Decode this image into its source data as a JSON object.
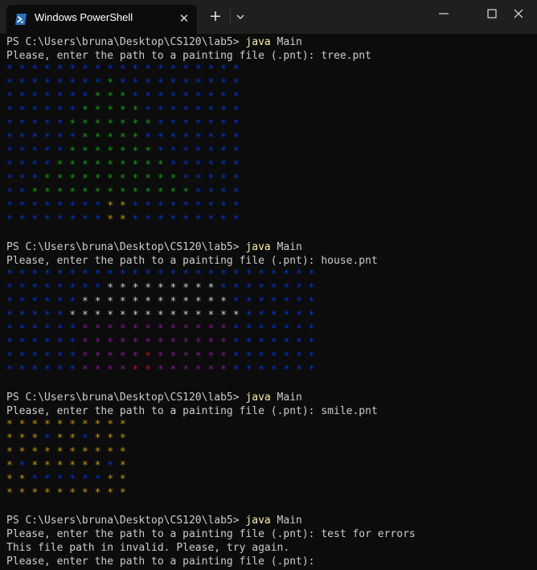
{
  "window": {
    "tab_title": "Windows PowerShell",
    "tab_icon": "powershell-icon",
    "new_tab_icon": "plus-icon",
    "dropdown_icon": "chevron-down-icon",
    "controls": [
      "minimize-icon",
      "maximize-icon",
      "close-icon"
    ],
    "colors": {
      "titlebar": "#1f1f1f",
      "terminal_bg": "#0c0c0c",
      "text": "#cccccc",
      "keyword": "#f9f1a5"
    }
  },
  "terminal": {
    "color_key": {
      "B": "#0037da",
      "G": "#13a10e",
      "Y": "#c19c00",
      "W": "#cccccc",
      "M": "#881798",
      "R": "#c50f1f"
    },
    "blocks": [
      {
        "prompt": "PS C:\\Users\\bruna\\Desktop\\CS120\\lab5> ",
        "command": "java",
        "args": " Main",
        "input_prompt": "Please, enter the path to a painting file (.pnt): tree.pnt",
        "grid": [
          "BBBBBBBBBBBBBBBBBBB",
          "BBBBBBBBGBBBBBBBBBB",
          "BBBBBBBGGGBBBBBBBBB",
          "BBBBBBGGGGGBBBBBBBB",
          "BBBBBGGGGGGGBBBBBBB",
          "BBBBBBGGGGGBBBBBBBB",
          "BBBBBGGGGGGGBBBBBBB",
          "BBBBGGGGGGGGGBBBBBB",
          "BBBGGGGGGGGGGGBBBBB",
          "BBGGGGGGGGGGGGGBBBB",
          "BBBBBBBBYYBBBBBBBBB",
          "BBBBBBBBYYBBBBBBBBB"
        ]
      },
      {
        "prompt": "PS C:\\Users\\bruna\\Desktop\\CS120\\lab5> ",
        "command": "java",
        "args": " Main",
        "input_prompt": "Please, enter the path to a painting file (.pnt): house.pnt",
        "grid": [
          "BBBBBBBBBBBBBBBBBBBBBBBBB",
          "BBBBBBBBWWWWWWWWWBBBBBBBB",
          "BBBBBBWWWWWWWWWWWWBBBBBBB",
          "BBBBBWWWWWWWWWWWWWWBBBBBB",
          "BBBBBBMMMMMMMMMMMMBBBBBBB",
          "BBBBBBMMMMMMMMMMMMBBBBBBB",
          "BBBBBBMMMMMRMMMMMMBBBBBBB",
          "BBBBBBMMMMRRMMMMMMBBBBBBB"
        ]
      },
      {
        "prompt": "PS C:\\Users\\bruna\\Desktop\\CS120\\lab5> ",
        "command": "java",
        "args": " Main",
        "input_prompt": "Please, enter the path to a painting file (.pnt): smile.pnt",
        "grid": [
          "YYYYYYYYYY",
          "YYYBYYBYYY",
          "YYYYYYYYYY",
          "YBYYYYYYBY",
          "YYBBBBBBYY",
          "YYYYYYYYYY"
        ]
      },
      {
        "prompt": "PS C:\\Users\\bruna\\Desktop\\CS120\\lab5> ",
        "command": "java",
        "args": " Main",
        "input_prompt": "Please, enter the path to a painting file (.pnt): test for errors",
        "messages": [
          "This file path in invalid. Please, try again.",
          "Please, enter the path to a painting file (.pnt): "
        ]
      }
    ]
  }
}
